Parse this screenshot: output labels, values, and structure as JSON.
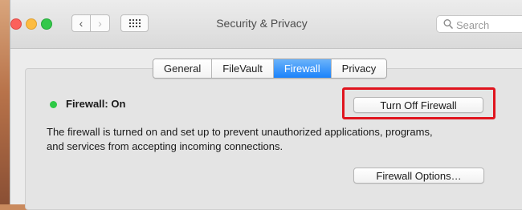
{
  "window": {
    "title": "Security & Privacy",
    "search_placeholder": "Search"
  },
  "toolbar": {
    "back_glyph": "‹",
    "forward_glyph": "›"
  },
  "tabs": [
    {
      "label": "General",
      "active": false
    },
    {
      "label": "FileVault",
      "active": false
    },
    {
      "label": "Firewall",
      "active": true
    },
    {
      "label": "Privacy",
      "active": false
    }
  ],
  "firewall": {
    "status_label": "Firewall: On",
    "status_color": "#2ec946",
    "toggle_button_label": "Turn Off Firewall",
    "description_line1": "The firewall is turned on and set up to prevent unauthorized applications, programs,",
    "description_line2": "and services from accepting incoming connections.",
    "options_button_label": "Firewall Options…"
  },
  "annotation": {
    "highlight_color": "#e0141e"
  },
  "icons": [
    "close-icon",
    "minimize-icon",
    "zoom-icon",
    "back-icon",
    "forward-icon",
    "show-all-grid-icon",
    "search-icon"
  ]
}
